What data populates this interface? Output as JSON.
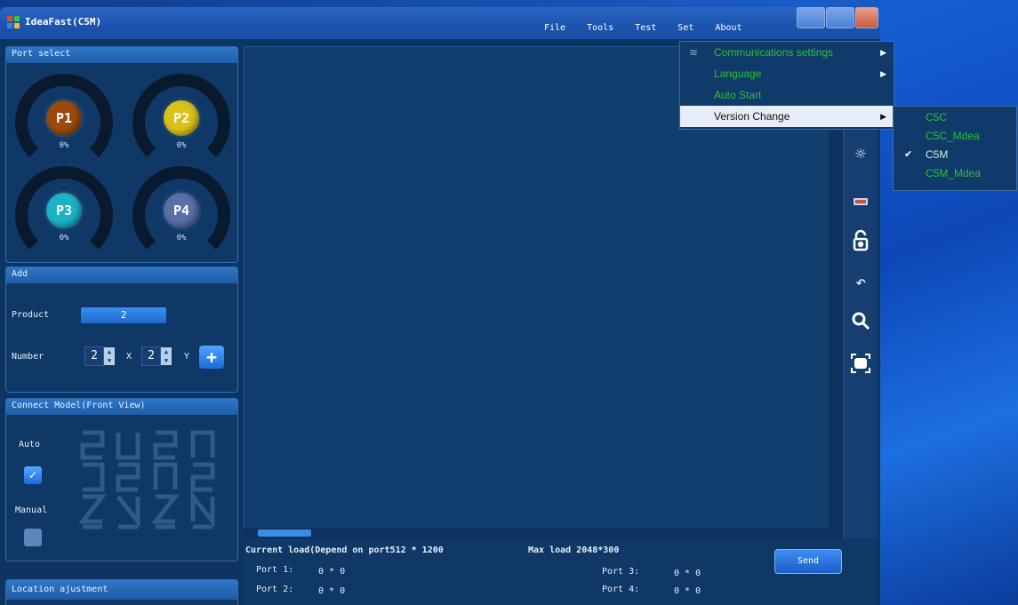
{
  "window": {
    "title": "IdeaFast(C5M)"
  },
  "menubar": [
    "File",
    "Tools",
    "Test",
    "Set",
    "About"
  ],
  "port_select": {
    "header": "Port select",
    "ports": [
      {
        "label": "P1",
        "percent": "0%",
        "color": "#9a4a0e"
      },
      {
        "label": "P2",
        "percent": "0%",
        "color": "#d9c21a"
      },
      {
        "label": "P3",
        "percent": "0%",
        "color": "#1cb3c9"
      },
      {
        "label": "P4",
        "percent": "0%",
        "color": "#5a6fa8"
      }
    ]
  },
  "add": {
    "header": "Add",
    "product_label": "Product",
    "product_value": "2",
    "number_label": "Number",
    "x_value": "2",
    "x_label": "X",
    "y_value": "2",
    "y_label": "Y"
  },
  "connect_model": {
    "header": "Connect Model(Front View)",
    "auto_label": "Auto",
    "manual_label": "Manual",
    "auto_checked": true,
    "manual_checked": false
  },
  "location": {
    "header": "Location ajustment"
  },
  "status": {
    "current_load": "Current load(Depend on port512 * 1200",
    "max_load": "Max load 2048*300",
    "port1_label": "Port 1:",
    "port1_value": "0 * 0",
    "port2_label": "Port 2:",
    "port2_value": "0 * 0",
    "port3_label": "Port 3:",
    "port3_value": "0 * 0",
    "port4_label": "Port 4:",
    "port4_value": "0 * 0",
    "send_label": "Send"
  },
  "set_menu": {
    "items": [
      {
        "label": "Communications settings",
        "has_submenu": true
      },
      {
        "label": "Language",
        "has_submenu": true
      },
      {
        "label": "Auto Start",
        "has_submenu": false
      },
      {
        "label": "Version Change",
        "has_submenu": true,
        "highlighted": true
      }
    ]
  },
  "version_submenu": {
    "items": [
      {
        "label": "C5C",
        "checked": false
      },
      {
        "label": "C5C_Mdea",
        "checked": false
      },
      {
        "label": "C5M",
        "checked": true
      },
      {
        "label": "C5M_Mdea",
        "checked": false
      }
    ]
  },
  "toolbar_icons": [
    "lightbulb-icon",
    "usb-icon",
    "unlock-icon",
    "undo-icon",
    "search-icon",
    "fit-screen-icon"
  ],
  "colors": {
    "accent": "#1f6ad0",
    "menu_text": "#2fbf3a"
  }
}
